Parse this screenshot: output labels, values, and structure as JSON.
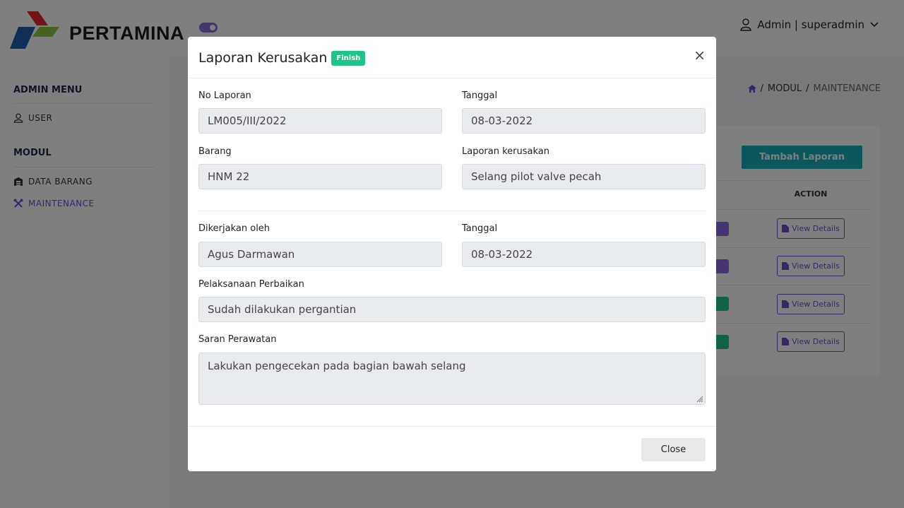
{
  "brand": {
    "name": "PERTAMINA"
  },
  "header": {
    "user_label": "Admin | superadmin"
  },
  "sidebar": {
    "admin_menu_title": "ADMIN MENU",
    "admin_items": [
      {
        "label": "USER",
        "icon": "user-icon"
      }
    ],
    "modul_title": "MODUL",
    "modul_items": [
      {
        "label": "DATA BARANG",
        "icon": "warehouse-icon"
      },
      {
        "label": "MAINTENANCE",
        "icon": "tools-icon",
        "active": true
      }
    ]
  },
  "breadcrumb": {
    "items": [
      "MODUL",
      "MAINTENANCE"
    ]
  },
  "page": {
    "add_button": "Tambah Laporan",
    "table": {
      "action_header": "ACTION",
      "row_action_label": "View Details",
      "rows": 4
    }
  },
  "modal": {
    "title": "Laporan Kerusakan",
    "status_badge": "Finish",
    "fields": {
      "no_laporan": {
        "label": "No Laporan",
        "value": "LM005/III/2022"
      },
      "tanggal": {
        "label": "Tanggal",
        "value": "08-03-2022"
      },
      "barang": {
        "label": "Barang",
        "value": "HNM 22"
      },
      "laporan_kerusakan": {
        "label": "Laporan kerusakan",
        "value": "Selang pilot valve pecah"
      },
      "dikerjakan_oleh": {
        "label": "Dikerjakan oleh",
        "value": "Agus Darmawan"
      },
      "tanggal_selesai": {
        "label": "Tanggal",
        "value": "08-03-2022"
      },
      "pelaksanaan": {
        "label": "Pelaksanaan Perbaikan",
        "value": "Sudah dilakukan pergantian"
      },
      "saran": {
        "label": "Saran Perawatan",
        "value": "Lakukan pengecekan pada bagian bawah selang"
      }
    },
    "close_button": "Close"
  },
  "colors": {
    "accent": "#6f4fd0",
    "teal": "#14b0b8",
    "badge_green": "#1ec48a"
  }
}
